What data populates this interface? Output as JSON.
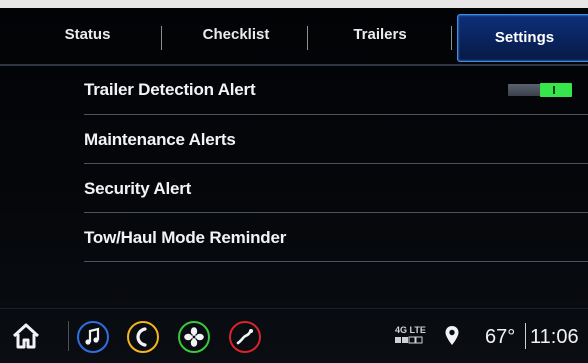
{
  "tabs": [
    {
      "label": "Status",
      "active": false
    },
    {
      "label": "Checklist",
      "active": false
    },
    {
      "label": "Trailers",
      "active": false
    },
    {
      "label": "Settings",
      "active": true
    }
  ],
  "settings": [
    {
      "label": "Trailer Detection Alert",
      "toggle": "on"
    },
    {
      "label": "Maintenance Alerts"
    },
    {
      "label": "Security Alert"
    },
    {
      "label": "Tow/Haul Mode Reminder"
    }
  ],
  "bottom_bar": {
    "apps": [
      {
        "name": "home-icon"
      },
      {
        "name": "music-icon",
        "color": "#2e6fe0"
      },
      {
        "name": "phone-icon",
        "color": "#f3b61a"
      },
      {
        "name": "fan-icon",
        "color": "#39c93a"
      },
      {
        "name": "performance-icon",
        "color": "#d9242a"
      }
    ],
    "network": "4G LTE",
    "location_icon": "location-pin-icon",
    "temperature": "67°",
    "time": "11:06"
  },
  "colors": {
    "accent": "#3a8de8",
    "toggle_on": "#36e64a"
  }
}
